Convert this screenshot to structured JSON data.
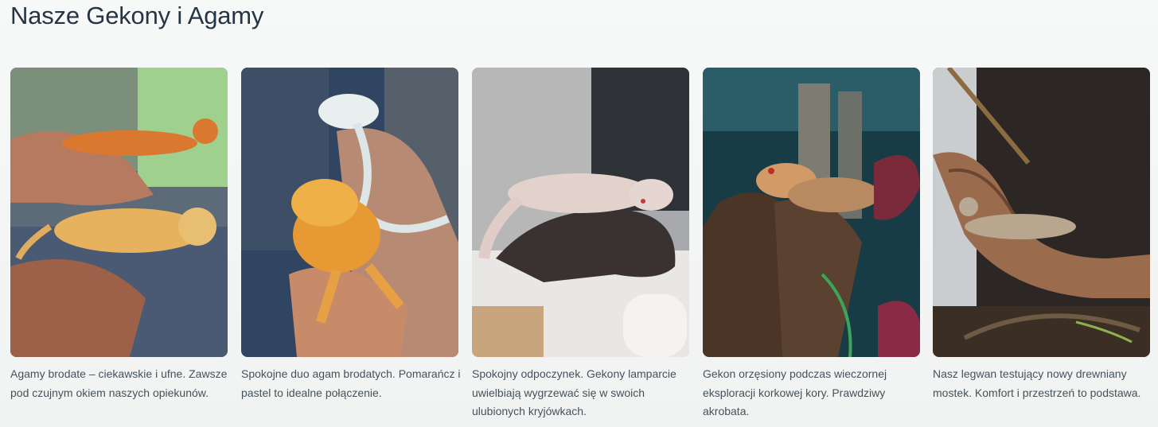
{
  "section": {
    "title": "Nasze Gekony i Agamy"
  },
  "cards": [
    {
      "image": "bearded-dragons-in-hands",
      "caption": "Agamy brodate – ciekawskie i ufne. Zawsze pod czujnym okiem naszych opiekunów."
    },
    {
      "image": "bearded-dragon-duo",
      "caption": "Spokojne duo agam brodatych. Pomarańcz i pastel to idealne połączenie."
    },
    {
      "image": "leopard-gecko-resting",
      "caption": "Spokojny odpoczynek. Gekony lamparcie uwielbiają wygrzewać się w swoich ulubionych kryjówkach."
    },
    {
      "image": "crested-gecko-on-cork",
      "caption": "Gekon orzęsiony podczas wieczornej eksploracji korkowej kory. Prawdziwy akrobata."
    },
    {
      "image": "iguana-on-bridge",
      "caption": "Nasz legwan testujący nowy drewniany mostek. Komfort i przestrzeń to podstawa."
    }
  ]
}
